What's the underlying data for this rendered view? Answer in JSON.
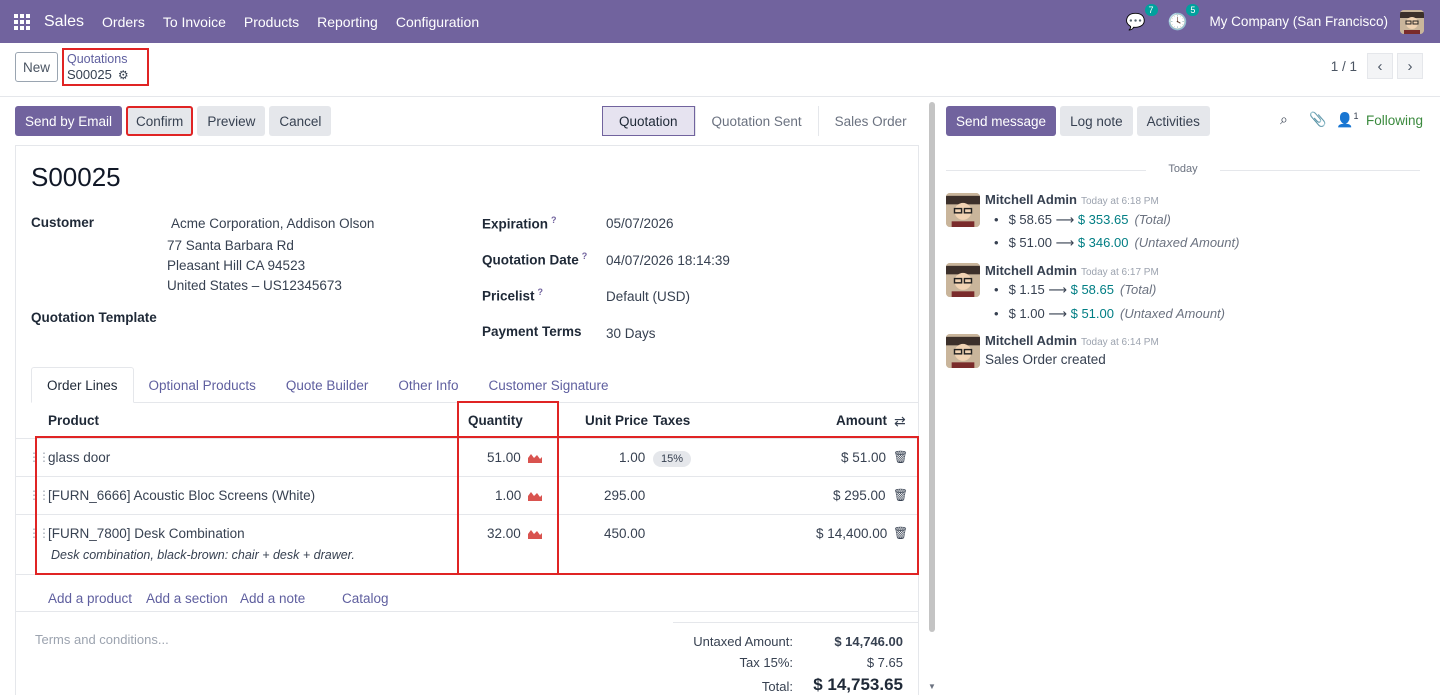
{
  "nav": {
    "app": "Sales",
    "menu": [
      "Orders",
      "To Invoice",
      "Products",
      "Reporting",
      "Configuration"
    ],
    "messages_count": "7",
    "activities_count": "5",
    "company": "My Company (San Francisco)"
  },
  "control": {
    "new_label": "New",
    "breadcrumb_parent": "Quotations",
    "breadcrumb_current": "S00025",
    "pager": "1 / 1"
  },
  "actions": {
    "send_email": "Send by Email",
    "confirm": "Confirm",
    "preview": "Preview",
    "cancel": "Cancel"
  },
  "stages": [
    "Quotation",
    "Quotation Sent",
    "Sales Order"
  ],
  "form": {
    "name": "S00025",
    "customer_label": "Customer",
    "customer_name": "Acme Corporation, Addison Olson",
    "address_1": "77 Santa Barbara Rd",
    "address_2": "Pleasant Hill CA 94523",
    "address_3": "United States – US12345673",
    "template_label": "Quotation Template",
    "expiration_label": "Expiration",
    "expiration": "05/07/2026",
    "quote_date_label": "Quotation Date",
    "quote_date": "04/07/2026 18:14:39",
    "pricelist_label": "Pricelist",
    "pricelist": "Default (USD)",
    "payment_terms_label": "Payment Terms",
    "payment_terms": "30 Days",
    "help_mark": "?"
  },
  "tabs": [
    "Order Lines",
    "Optional Products",
    "Quote Builder",
    "Other Info",
    "Customer Signature"
  ],
  "table": {
    "headers": {
      "product": "Product",
      "quantity": "Quantity",
      "unit_price": "Unit Price",
      "taxes": "Taxes",
      "amount": "Amount"
    },
    "rows": [
      {
        "product": "glass door",
        "quantity": "51.00",
        "unit_price": "1.00",
        "tax": "15%",
        "amount": "$ 51.00",
        "description": ""
      },
      {
        "product": "[FURN_6666] Acoustic Bloc Screens (White)",
        "quantity": "1.00",
        "unit_price": "295.00",
        "tax": "",
        "amount": "$ 295.00",
        "description": ""
      },
      {
        "product": "[FURN_7800] Desk Combination",
        "quantity": "32.00",
        "unit_price": "450.00",
        "tax": "",
        "amount": "$ 14,400.00",
        "description": "Desk combination, black-brown: chair + desk + drawer."
      }
    ],
    "add_product": "Add a product",
    "add_section": "Add a section",
    "add_note": "Add a note",
    "catalog": "Catalog"
  },
  "footer": {
    "terms_placeholder": "Terms and conditions...",
    "untaxed_label": "Untaxed Amount:",
    "untaxed": "$ 14,746.00",
    "tax_label": "Tax 15%:",
    "tax": "$ 7.65",
    "total_label": "Total:",
    "total": "$ 14,753.65"
  },
  "chatter": {
    "send_message": "Send message",
    "log_note": "Log note",
    "activities": "Activities",
    "followers_count": "1",
    "following": "Following",
    "date_sep": "Today",
    "messages": [
      {
        "author": "Mitchell Admin",
        "time": "Today at 6:18 PM",
        "changes": [
          {
            "old": "$ 58.65",
            "new": "$ 353.65",
            "field": "(Total)"
          },
          {
            "old": "$ 51.00",
            "new": "$ 346.00",
            "field": "(Untaxed Amount)"
          }
        ]
      },
      {
        "author": "Mitchell Admin",
        "time": "Today at 6:17 PM",
        "changes": [
          {
            "old": "$ 1.15",
            "new": "$ 58.65",
            "field": "(Total)"
          },
          {
            "old": "$ 1.00",
            "new": "$ 51.00",
            "field": "(Untaxed Amount)"
          }
        ]
      },
      {
        "author": "Mitchell Admin",
        "time": "Today at 6:14 PM",
        "body": "Sales Order created"
      }
    ]
  },
  "colors": {
    "brand": "#71639e",
    "highlight": "#e02424",
    "following": "#3b8a3e",
    "tracking_new": "#017e84"
  }
}
